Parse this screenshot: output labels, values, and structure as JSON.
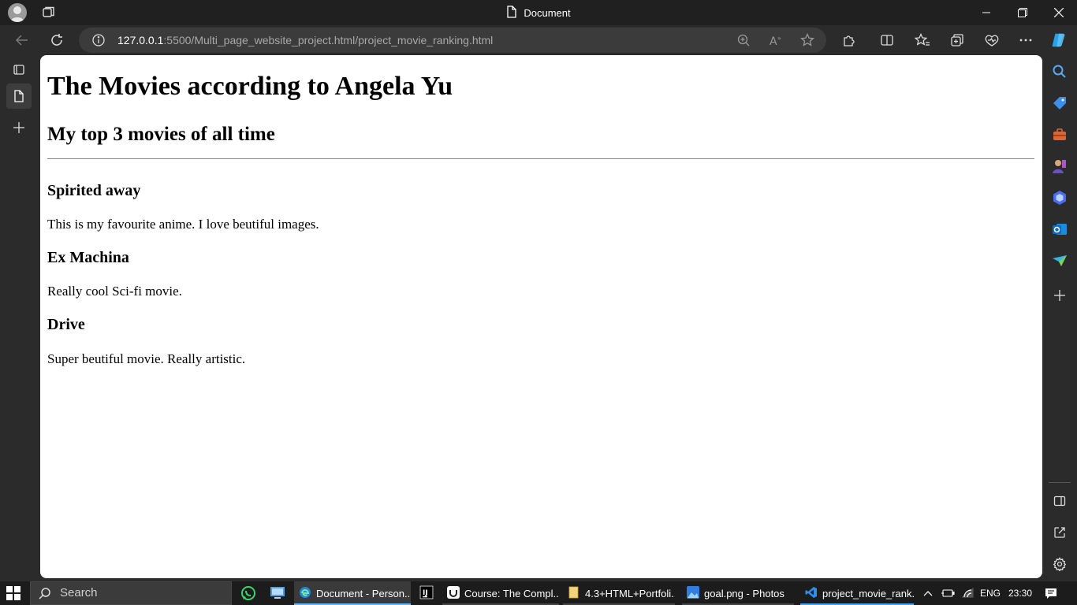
{
  "window": {
    "title": "Document"
  },
  "address_bar": {
    "url_host": "127.0.0.1",
    "url_rest": ":5500/Multi_page_website_project.html/project_movie_ranking.html"
  },
  "page": {
    "heading": "The Movies according to Angela Yu",
    "subheading": "My top 3 movies of all time",
    "movies": [
      {
        "title": "Spirited away",
        "description": "This is my favourite anime. I love beutiful images."
      },
      {
        "title": "Ex Machina",
        "description": "Really cool Sci-fi movie."
      },
      {
        "title": "Drive",
        "description": "Super beutiful movie. Really artistic."
      }
    ]
  },
  "taskbar": {
    "search_label": "Search",
    "items": [
      {
        "label": "Document - Person...",
        "icon": "edge-icon"
      },
      {
        "label": "",
        "icon": "intellij-icon"
      },
      {
        "label": "Course: The Compl...",
        "icon": "udemy-icon"
      },
      {
        "label": "4.3+HTML+Portfoli...",
        "icon": "folder-icon"
      },
      {
        "label": "goal.png - Photos",
        "icon": "photos-icon"
      },
      {
        "label": "project_movie_rank...",
        "icon": "vscode-icon"
      }
    ],
    "language": "ENG",
    "time": "23:30"
  },
  "colors": {
    "chrome_bg": "#2b2b2b",
    "titlebar_bg": "#202020",
    "page_bg": "#ffffff",
    "taskbar_bg": "#1c1c1c",
    "accent": "#4c9fe8"
  }
}
